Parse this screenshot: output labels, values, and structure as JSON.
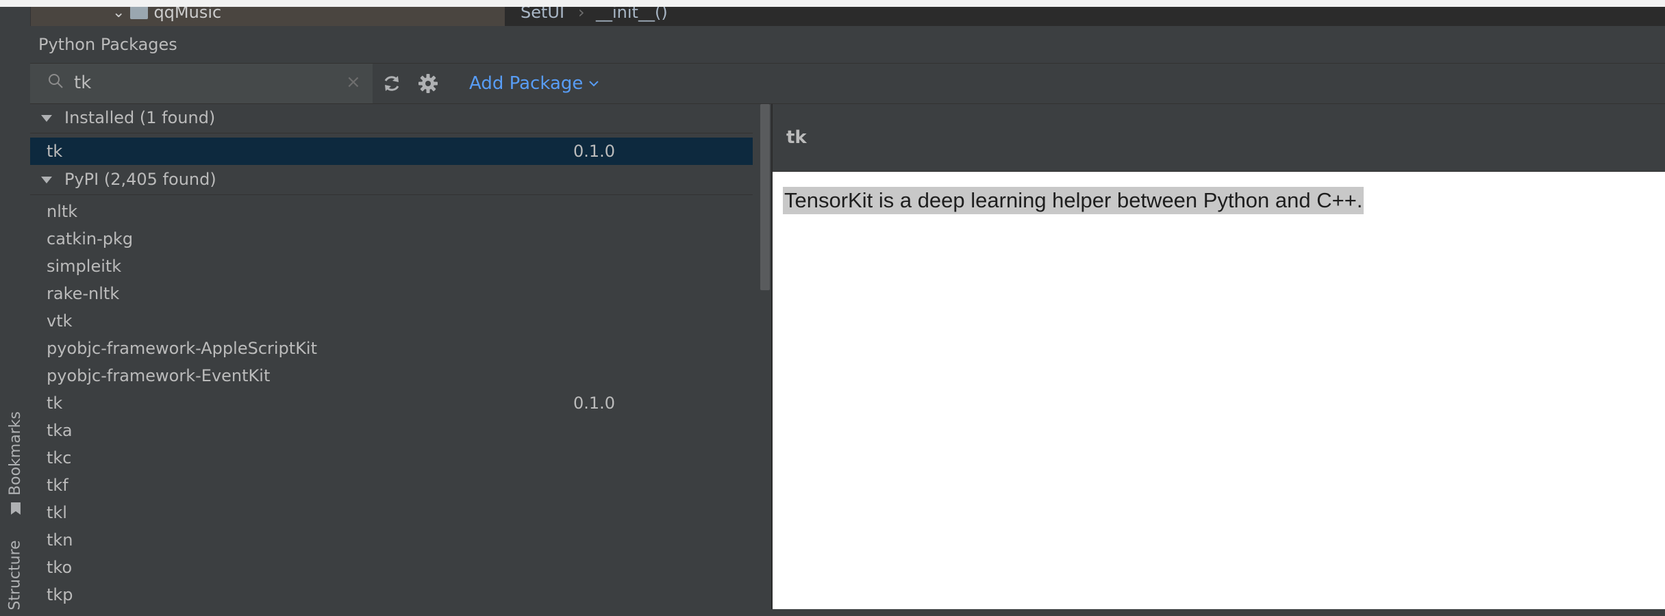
{
  "editor": {
    "folder_label": "qqMusic",
    "breadcrumb": [
      "SetUI",
      "__init__()"
    ],
    "breadcrumb_sep": "›"
  },
  "side_tabs": {
    "bookmarks": "Bookmarks",
    "structure": "Structure"
  },
  "tool_window": {
    "title": "Python Packages"
  },
  "toolbar": {
    "search_value": "tk",
    "clear_glyph": "×",
    "add_package_label": "Add Package"
  },
  "installed": {
    "header": "Installed (1 found)",
    "items": [
      {
        "name": "tk",
        "version": "0.1.0"
      }
    ]
  },
  "pypi": {
    "header": "PyPI (2,405 found)",
    "items": [
      {
        "name": "nltk",
        "version": ""
      },
      {
        "name": "catkin-pkg",
        "version": ""
      },
      {
        "name": "simpleitk",
        "version": ""
      },
      {
        "name": "rake-nltk",
        "version": ""
      },
      {
        "name": "vtk",
        "version": ""
      },
      {
        "name": "pyobjc-framework-AppleScriptKit",
        "version": ""
      },
      {
        "name": "pyobjc-framework-EventKit",
        "version": ""
      },
      {
        "name": "tk",
        "version": "0.1.0"
      },
      {
        "name": "tka",
        "version": ""
      },
      {
        "name": "tkc",
        "version": ""
      },
      {
        "name": "tkf",
        "version": ""
      },
      {
        "name": "tkl",
        "version": ""
      },
      {
        "name": "tkn",
        "version": ""
      },
      {
        "name": "tko",
        "version": ""
      },
      {
        "name": "tkp",
        "version": ""
      }
    ]
  },
  "detail": {
    "package_name": "tk",
    "description": "TensorKit is a deep learning helper between Python and C++."
  },
  "colors": {
    "accent": "#589df6",
    "selection": "#0d293e",
    "panel": "#3c3f41"
  }
}
